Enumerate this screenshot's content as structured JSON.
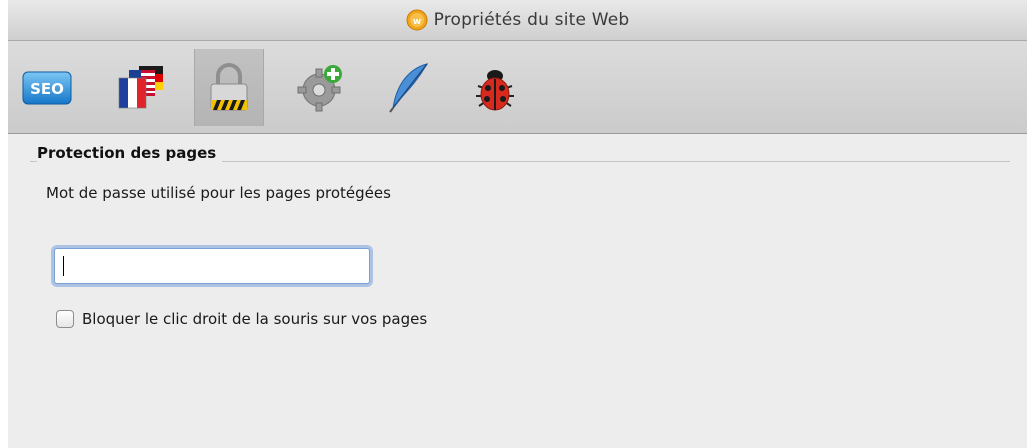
{
  "window": {
    "title": "Propriétés du site Web",
    "app_icon": "iweb-app-icon"
  },
  "toolbar": {
    "items": [
      {
        "icon": "seo-icon",
        "label": "SEO",
        "selected": false
      },
      {
        "icon": "flags-icon",
        "selected": false
      },
      {
        "icon": "lock-icon",
        "selected": true
      },
      {
        "icon": "gear-plus-icon",
        "selected": false
      },
      {
        "icon": "feather-icon",
        "selected": false
      },
      {
        "icon": "ladybug-icon",
        "selected": false
      }
    ]
  },
  "section": {
    "title": "Protection des pages",
    "password_label": "Mot de passe utilisé pour les pages protégées",
    "password_value": "",
    "password_placeholder": "",
    "block_right_click_label": "Bloquer le clic droit de la souris sur vos pages",
    "block_right_click_checked": false
  },
  "colors": {
    "window_bg": "#ededed",
    "focus_ring": "#78a0dc"
  }
}
